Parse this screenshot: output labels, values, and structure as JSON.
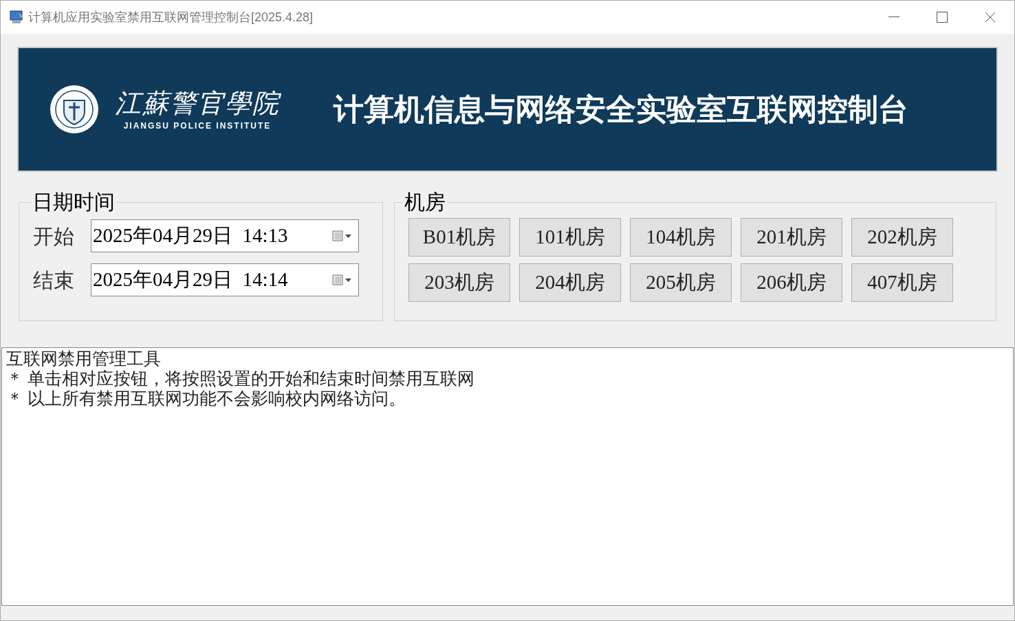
{
  "window": {
    "title": "计算机应用实验室禁用互联网管理控制台[2025.4.28]"
  },
  "banner": {
    "logo_name": "江蘇警官學院",
    "logo_subtitle": "JIANGSU POLICE INSTITUTE",
    "title": "计算机信息与网络安全实验室互联网控制台"
  },
  "datetime_group": {
    "title": "日期时间",
    "fields": [
      {
        "label": "开始",
        "value": "2025年04月29日  14:13"
      },
      {
        "label": "结束",
        "value": "2025年04月29日  14:14"
      }
    ]
  },
  "rooms_group": {
    "title": "机房",
    "buttons": [
      "B01机房",
      "101机房",
      "104机房",
      "201机房",
      "202机房",
      "203机房",
      "204机房",
      "205机房",
      "206机房",
      "407机房"
    ]
  },
  "log": {
    "lines": [
      "互联网禁用管理工具",
      "＊ 单击相对应按钮，将按照设置的开始和结束时间禁用互联网",
      "＊ 以上所有禁用互联网功能不会影响校内网络访问。"
    ]
  }
}
